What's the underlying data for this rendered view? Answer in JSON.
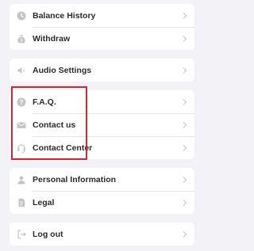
{
  "groups": [
    {
      "items": [
        {
          "label": "Balance History",
          "icon": "clock-icon"
        },
        {
          "label": "Withdraw",
          "icon": "money-bag-icon"
        }
      ]
    },
    {
      "items": [
        {
          "label": "Audio Settings",
          "icon": "speaker-icon"
        }
      ]
    },
    {
      "items": [
        {
          "label": "F.A.Q.",
          "icon": "question-icon"
        },
        {
          "label": "Contact us",
          "icon": "envelope-icon"
        },
        {
          "label": "Contact Center",
          "icon": "headset-icon"
        }
      ]
    },
    {
      "items": [
        {
          "label": "Personal Information",
          "icon": "person-icon"
        },
        {
          "label": "Legal",
          "icon": "document-icon"
        }
      ]
    },
    {
      "items": [
        {
          "label": "Log out",
          "icon": "logout-icon"
        }
      ]
    }
  ],
  "colors": {
    "background": "#f2f2f7",
    "card": "#ffffff",
    "highlight": "#d8223a",
    "icon": "#c4c4c8",
    "chevron": "#c8c8cc"
  }
}
